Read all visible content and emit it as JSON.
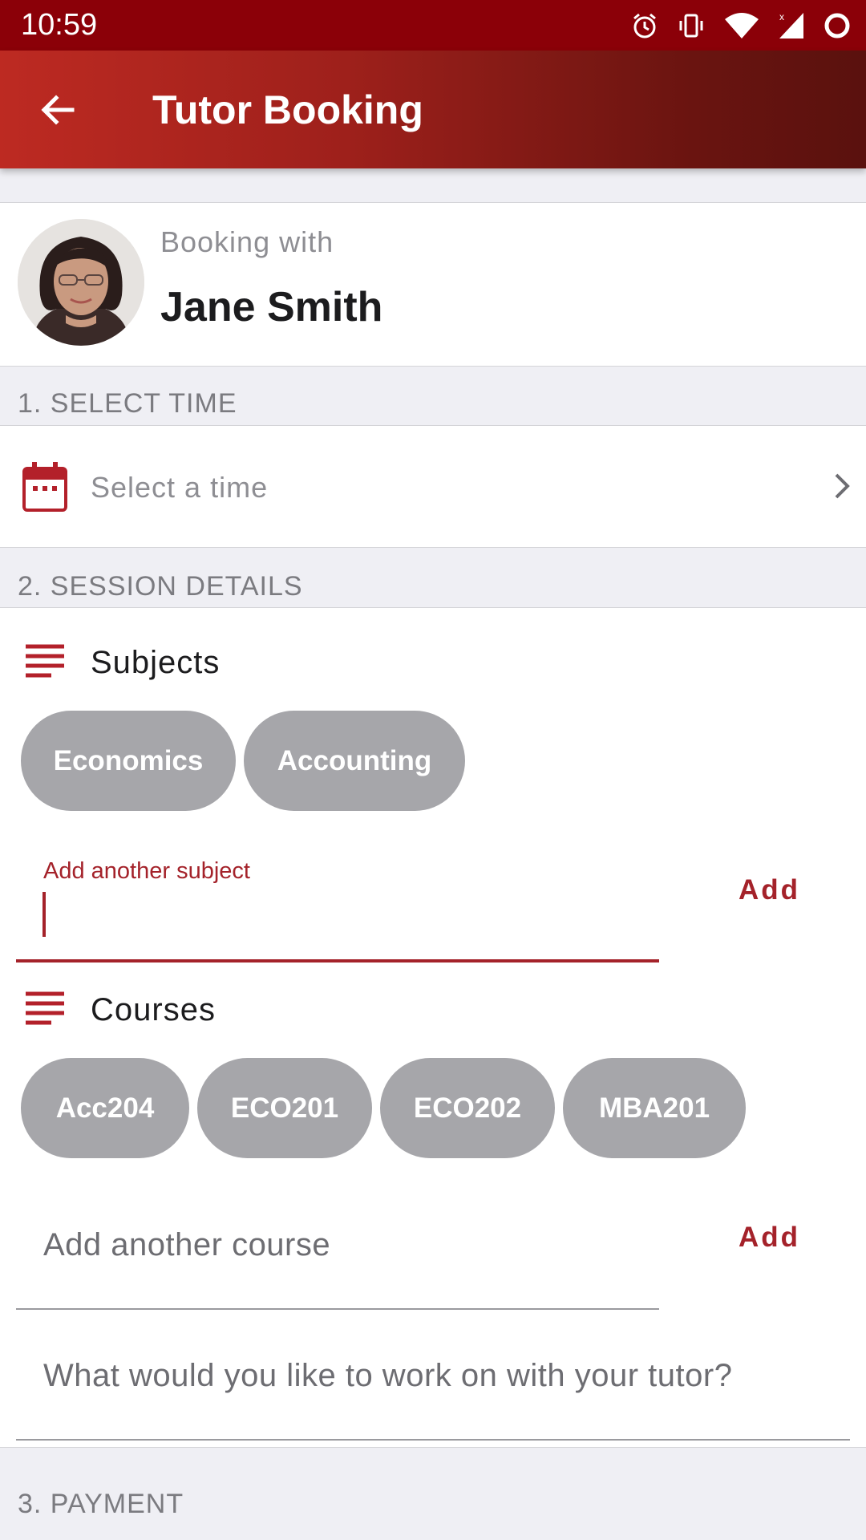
{
  "status_bar": {
    "time": "10:59",
    "icons": [
      "alarm-icon",
      "vibrate-icon",
      "wifi-icon",
      "signal-icon",
      "ring-icon"
    ]
  },
  "app_bar": {
    "back_icon": "arrow-left-icon",
    "title": "Tutor Booking"
  },
  "tutor": {
    "label": "Booking with",
    "name": "Jane Smith"
  },
  "sections": {
    "select_time": "1. SELECT TIME",
    "session_details": "2. SESSION DETAILS",
    "payment": "3. PAYMENT"
  },
  "time_picker": {
    "placeholder": "Select a time"
  },
  "subjects": {
    "label": "Subjects",
    "chips": [
      "Economics",
      "Accounting"
    ],
    "input_label": "Add another subject",
    "add_label": "Add"
  },
  "courses": {
    "label": "Courses",
    "chips": [
      "Acc204",
      "ECO201",
      "ECO202",
      "MBA201"
    ],
    "placeholder": "Add another course",
    "add_label": "Add"
  },
  "notes": {
    "placeholder": "What would you like to work on with your tutor?"
  },
  "colors": {
    "status_bar": "#8b0008",
    "accent": "#a4222a",
    "chip": "#a6a6aa",
    "background": "#efeff4"
  }
}
